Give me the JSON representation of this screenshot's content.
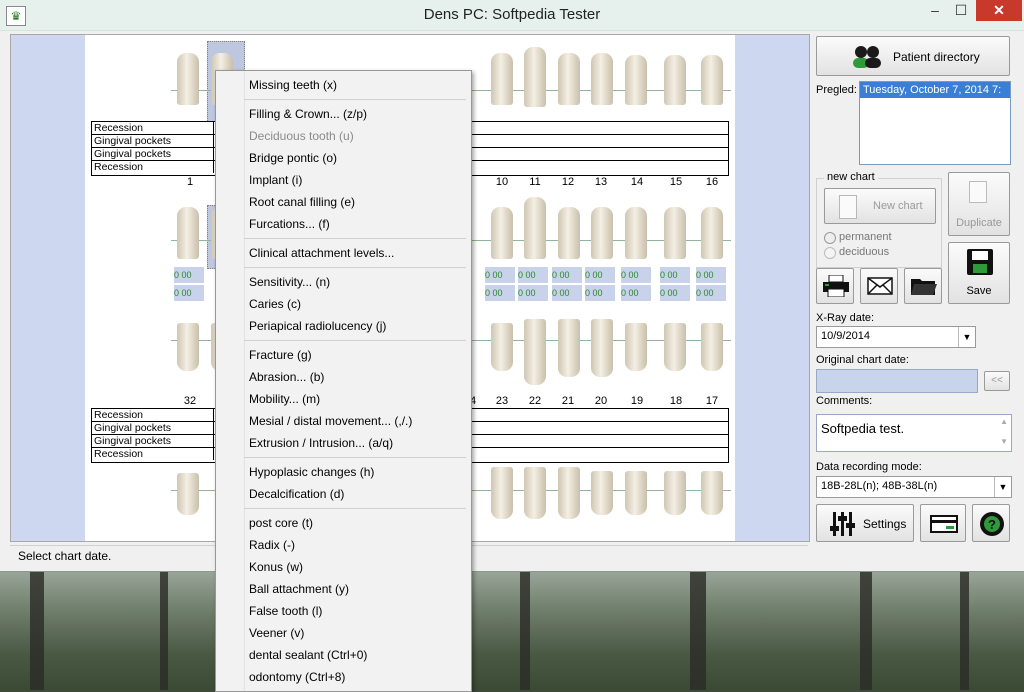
{
  "window": {
    "title": "Dens PC: Softpedia Tester",
    "minimize": "–",
    "maximize": "☐",
    "close": "✕",
    "app_icon": "tooth-icon"
  },
  "chart": {
    "grid_labels": [
      "Recession",
      "Gingival pockets",
      "Gingival pockets",
      "Recession"
    ],
    "upper_numbers": [
      "1",
      "10",
      "11",
      "12",
      "13",
      "14",
      "15",
      "16"
    ],
    "lower_numbers": [
      "32",
      "4",
      "23",
      "22",
      "21",
      "20",
      "19",
      "18",
      "17"
    ],
    "cell_values": [
      "0",
      "00"
    ]
  },
  "status": {
    "text": "Select chart date."
  },
  "panel": {
    "patient_directory": "Patient directory",
    "pregled_label": "Pregled:",
    "pregled_selected": "Tuesday, October 7, 2014 7:",
    "new_chart_group": "new chart",
    "new_chart": "New chart",
    "duplicate": "Duplicate",
    "permanent": "permanent",
    "deciduous": "deciduous",
    "save": "Save",
    "xray_label": "X-Ray date:",
    "xray_value": "10/9/2014",
    "orig_label": "Original chart date:",
    "back_btn": "<<",
    "comments_label": "Comments:",
    "comments_value": "Softpedia test.",
    "mode_label": "Data recording mode:",
    "mode_value": "18B-28L(n); 48B-38L(n)",
    "settings": "Settings"
  },
  "menu": [
    {
      "label": "Missing teeth (x)"
    },
    {
      "sep": true
    },
    {
      "label": "Filling & Crown... (z/p)"
    },
    {
      "label": "Deciduous tooth (u)",
      "disabled": true
    },
    {
      "label": "Bridge pontic (o)"
    },
    {
      "label": "Implant (i)"
    },
    {
      "label": "Root canal filling (e)"
    },
    {
      "label": "Furcations... (f)"
    },
    {
      "sep": true
    },
    {
      "label": "Clinical attachment levels..."
    },
    {
      "sep": true
    },
    {
      "label": "Sensitivity... (n)"
    },
    {
      "label": "Caries (c)"
    },
    {
      "label": "Periapical radiolucency (j)"
    },
    {
      "sep": true
    },
    {
      "label": "Fracture (g)"
    },
    {
      "label": "Abrasion... (b)"
    },
    {
      "label": "Mobility... (m)"
    },
    {
      "label": "Mesial / distal movement... (,/.)"
    },
    {
      "label": "Extrusion / Intrusion... (a/q)"
    },
    {
      "sep": true
    },
    {
      "label": "Hypoplasic changes (h)"
    },
    {
      "label": "Decalcification (d)"
    },
    {
      "sep": true
    },
    {
      "label": "post  core (t)"
    },
    {
      "label": "Radix (-)"
    },
    {
      "label": "Konus (w)"
    },
    {
      "label": "Ball attachment (y)"
    },
    {
      "label": "False tooth (l)"
    },
    {
      "label": "Veener (v)"
    },
    {
      "label": "dental sealant (Ctrl+0)"
    },
    {
      "label": "odontomy (Ctrl+8)"
    }
  ]
}
